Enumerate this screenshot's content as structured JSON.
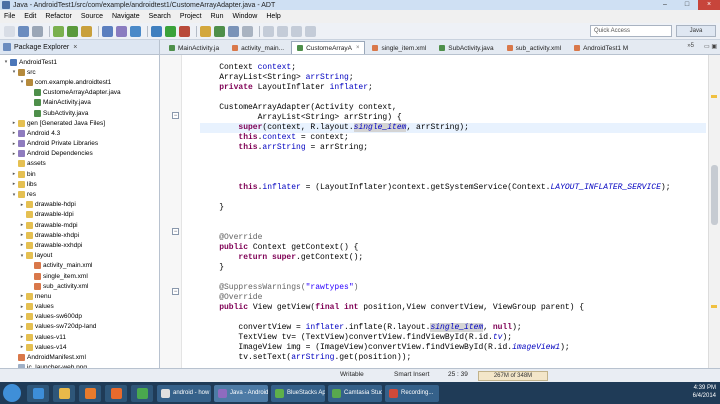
{
  "window": {
    "title": "Java - AndroidTest1/src/com/example/androidtest1/CustomeArrayAdapter.java - ADT",
    "controls": [
      "–",
      "□",
      "×"
    ]
  },
  "menu": [
    "File",
    "Edit",
    "Refactor",
    "Source",
    "Navigate",
    "Search",
    "Project",
    "Run",
    "Window",
    "Help"
  ],
  "toolbar": {
    "quick_access_placeholder": "Quick Access",
    "perspective": "Java"
  },
  "package_explorer": {
    "title": "Package Explorer",
    "close": "×",
    "tree": [
      {
        "label": "AndroidTest1",
        "depth": 0,
        "icon": "project-icon",
        "twisty": "▾"
      },
      {
        "label": "src",
        "depth": 1,
        "icon": "package-icon",
        "twisty": "▾"
      },
      {
        "label": "com.example.androidtest1",
        "depth": 2,
        "icon": "package-icon",
        "twisty": "▾"
      },
      {
        "label": "CustomeArrayAdapter.java",
        "depth": 3,
        "icon": "java-icon",
        "twisty": ""
      },
      {
        "label": "MainActivity.java",
        "depth": 3,
        "icon": "java-icon",
        "twisty": ""
      },
      {
        "label": "SubActivity.java",
        "depth": 3,
        "icon": "java-icon",
        "twisty": ""
      },
      {
        "label": "gen [Generated Java Files]",
        "depth": 1,
        "icon": "folder-icon",
        "twisty": "▸"
      },
      {
        "label": "Android 4.3",
        "depth": 1,
        "icon": "library-icon",
        "twisty": "▸"
      },
      {
        "label": "Android Private Libraries",
        "depth": 1,
        "icon": "library-icon",
        "twisty": "▸"
      },
      {
        "label": "Android Dependencies",
        "depth": 1,
        "icon": "library-icon",
        "twisty": "▸"
      },
      {
        "label": "assets",
        "depth": 1,
        "icon": "folder-icon",
        "twisty": ""
      },
      {
        "label": "bin",
        "depth": 1,
        "icon": "folder-icon",
        "twisty": "▸"
      },
      {
        "label": "libs",
        "depth": 1,
        "icon": "folder-icon",
        "twisty": "▸"
      },
      {
        "label": "res",
        "depth": 1,
        "icon": "folder-icon",
        "twisty": "▾"
      },
      {
        "label": "drawable-hdpi",
        "depth": 2,
        "icon": "folder-icon",
        "twisty": "▸"
      },
      {
        "label": "drawable-ldpi",
        "depth": 2,
        "icon": "folder-icon",
        "twisty": ""
      },
      {
        "label": "drawable-mdpi",
        "depth": 2,
        "icon": "folder-icon",
        "twisty": "▸"
      },
      {
        "label": "drawable-xhdpi",
        "depth": 2,
        "icon": "folder-icon",
        "twisty": "▸"
      },
      {
        "label": "drawable-xxhdpi",
        "depth": 2,
        "icon": "folder-icon",
        "twisty": "▸"
      },
      {
        "label": "layout",
        "depth": 2,
        "icon": "folder-icon",
        "twisty": "▾"
      },
      {
        "label": "activity_main.xml",
        "depth": 3,
        "icon": "xml-icon",
        "twisty": ""
      },
      {
        "label": "single_item.xml",
        "depth": 3,
        "icon": "xml-icon",
        "twisty": ""
      },
      {
        "label": "sub_activity.xml",
        "depth": 3,
        "icon": "xml-icon",
        "twisty": ""
      },
      {
        "label": "menu",
        "depth": 2,
        "icon": "folder-icon",
        "twisty": "▸"
      },
      {
        "label": "values",
        "depth": 2,
        "icon": "folder-icon",
        "twisty": "▸"
      },
      {
        "label": "values-sw600dp",
        "depth": 2,
        "icon": "folder-icon",
        "twisty": "▸"
      },
      {
        "label": "values-sw720dp-land",
        "depth": 2,
        "icon": "folder-icon",
        "twisty": "▸"
      },
      {
        "label": "values-v11",
        "depth": 2,
        "icon": "folder-icon",
        "twisty": "▸"
      },
      {
        "label": "values-v14",
        "depth": 2,
        "icon": "folder-icon",
        "twisty": "▸"
      },
      {
        "label": "AndroidManifest.xml",
        "depth": 1,
        "icon": "xml-icon",
        "twisty": ""
      },
      {
        "label": "ic_launcher-web.png",
        "depth": 1,
        "icon": "file-icon",
        "twisty": ""
      },
      {
        "label": "proguard-project.txt",
        "depth": 1,
        "icon": "file-icon",
        "twisty": ""
      }
    ]
  },
  "editor": {
    "tabs": [
      {
        "label": "MainActivity.ja",
        "kind": "java",
        "active": false
      },
      {
        "label": "activity_main...",
        "kind": "xml",
        "active": false
      },
      {
        "label": "CustomeArrayA",
        "kind": "java",
        "active": true
      },
      {
        "label": "single_item.xml",
        "kind": "xml",
        "active": false
      },
      {
        "label": "SubActivity.java",
        "kind": "java",
        "active": false
      },
      {
        "label": "sub_activity.xml",
        "kind": "xml",
        "active": false
      },
      {
        "label": "AndroidTest1 M",
        "kind": "xml",
        "active": false
      }
    ],
    "more_tabs": "»5",
    "code_lines": [
      [
        [
          "",
          "    Context "
        ],
        [
          "fld",
          "context"
        ],
        [
          "",
          ";"
        ]
      ],
      [
        [
          "",
          "    ArrayList<String> "
        ],
        [
          "fld",
          "arrString"
        ],
        [
          "",
          ";"
        ]
      ],
      [
        [
          "kw",
          "    private "
        ],
        [
          "",
          "LayoutInflater "
        ],
        [
          "fld",
          "inflater"
        ],
        [
          "",
          ";"
        ]
      ],
      [],
      [
        [
          "",
          "    CustomeArrayAdapter(Activity context,"
        ]
      ],
      [
        [
          "",
          "            ArrayList<String> arrString) {"
        ]
      ],
      [
        [
          "kw",
          "        super"
        ],
        [
          "",
          "(context, R.layout."
        ],
        [
          "sfld hl",
          "single_item"
        ],
        [
          "",
          ", arrString);"
        ]
      ],
      [
        [
          "kw",
          "        this"
        ],
        [
          "",
          "."
        ],
        [
          "fld",
          "context"
        ],
        [
          "",
          " = context;"
        ]
      ],
      [
        [
          "kw",
          "        this"
        ],
        [
          "",
          "."
        ],
        [
          "fld",
          "arrString"
        ],
        [
          "",
          " = arrString;"
        ]
      ],
      [],
      [],
      [],
      [
        [
          "kw",
          "        this"
        ],
        [
          "",
          "."
        ],
        [
          "fld",
          "inflater"
        ],
        [
          "",
          " = (LayoutInflater)context.getSystemService(Context."
        ],
        [
          "sfld",
          "LAYOUT_INFLATER_SERVICE"
        ],
        [
          "",
          ");"
        ]
      ],
      [],
      [
        [
          "",
          "    }"
        ]
      ],
      [],
      [],
      [
        [
          "ann",
          "    @Override"
        ]
      ],
      [
        [
          "kw",
          "    public "
        ],
        [
          "",
          "Context getContext() {"
        ]
      ],
      [
        [
          "kw",
          "        return super"
        ],
        [
          "",
          ".getContext();"
        ]
      ],
      [
        [
          "",
          "    }"
        ]
      ],
      [],
      [
        [
          "ann",
          "    @SuppressWarnings("
        ],
        [
          "str",
          "\"rawtypes\""
        ],
        [
          "ann",
          ")"
        ]
      ],
      [
        [
          "ann",
          "    @Override"
        ]
      ],
      [
        [
          "kw",
          "    public "
        ],
        [
          "",
          "View getView("
        ],
        [
          "kw",
          "final int "
        ],
        [
          "",
          "position,View convertView, ViewGroup parent) {"
        ]
      ],
      [],
      [
        [
          "",
          "        convertView = "
        ],
        [
          "fld",
          "inflater"
        ],
        [
          "",
          ".inflate(R.layout."
        ],
        [
          "sfld hl",
          "single_item"
        ],
        [
          "",
          ", "
        ],
        [
          "kw",
          "null"
        ],
        [
          "",
          ");"
        ]
      ],
      [
        [
          "",
          "        TextView tv= (TextView)convertView.findViewById(R.id."
        ],
        [
          "sfld",
          "tv"
        ],
        [
          "",
          ");"
        ]
      ],
      [
        [
          "",
          "        ImageView img = (ImageView)convertView.findViewById(R.id."
        ],
        [
          "sfld",
          "imageView1"
        ],
        [
          "",
          ");"
        ]
      ],
      [
        [
          "",
          "        tv.setText("
        ],
        [
          "fld",
          "arrString"
        ],
        [
          "",
          ".get(position));"
        ]
      ]
    ]
  },
  "status": {
    "writable": "Writable",
    "insert_mode": "Smart Insert",
    "cursor": "25 : 39",
    "heap": "267M of 348M"
  },
  "taskbar": {
    "tasks": [
      {
        "label": "android - how t...",
        "color": "#e0e0e0",
        "active": false
      },
      {
        "label": "Java - AndroidT...",
        "color": "#8e6bbf",
        "active": true
      },
      {
        "label": "BlueStacks App...",
        "color": "#5fb04a",
        "active": false
      },
      {
        "label": "Camtasia Studio...",
        "color": "#58a84e",
        "active": false
      },
      {
        "label": "Recording...",
        "color": "#d04a3a",
        "active": false
      }
    ],
    "pinned": [
      {
        "name": "ie-icon",
        "color": "#3d8ed8"
      },
      {
        "name": "explorer-icon",
        "color": "#e8b94a"
      },
      {
        "name": "media-player-icon",
        "color": "#e87b2c"
      },
      {
        "name": "firefox-icon",
        "color": "#e86a2c"
      },
      {
        "name": "chrome-icon",
        "color": "#4aa84e"
      }
    ],
    "time": "4:39 PM",
    "date": "6/4/2014"
  }
}
